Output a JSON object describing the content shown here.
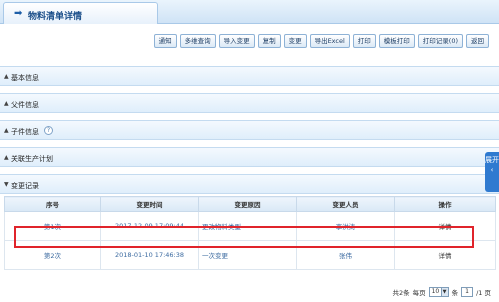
{
  "title": {
    "text": "物料清单详情"
  },
  "toolbar": {
    "buttons": [
      "通知",
      "多维查询",
      "导入变更",
      "复制",
      "变更",
      "导出Excel",
      "打印",
      "模板打印",
      "打印记录(0)",
      "返回"
    ]
  },
  "sections": {
    "basic": "基本信息",
    "parent": "父件信息",
    "child": "子件信息",
    "plan": "关联生产计划",
    "changes": "变更记录"
  },
  "side_tab": {
    "label": "展开"
  },
  "table": {
    "headers": [
      "序号",
      "变更时间",
      "变更原因",
      "变更人员",
      "操作"
    ],
    "rows": [
      [
        "第1次",
        "2017-12-09 17:09:44",
        "更改物料类型",
        "李洪涛",
        "详情"
      ],
      [
        "第2次",
        "2018-01-10 17:46:38",
        "一次变更",
        "张伟",
        "详情"
      ]
    ]
  },
  "pager": {
    "total": "共2条",
    "per_page_label": "每页",
    "per_page_value": "10",
    "unit": "条",
    "current_page": "1",
    "total_pages": "/1 页"
  }
}
